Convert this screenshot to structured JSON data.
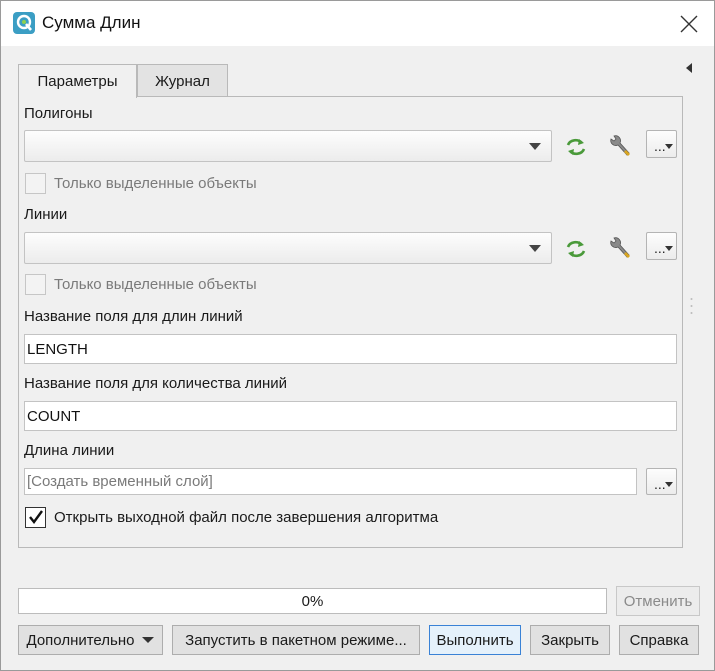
{
  "window": {
    "title": "Сумма Длин"
  },
  "tabs": [
    {
      "label": "Параметры",
      "active": true
    },
    {
      "label": "Журнал",
      "active": false
    }
  ],
  "params": {
    "polygons": {
      "label": "Полигоны",
      "value": "",
      "selected_only_label": "Только выделенные объекты",
      "selected_only_checked": false
    },
    "lines": {
      "label": "Линии",
      "value": "",
      "selected_only_label": "Только выделенные объекты",
      "selected_only_checked": false
    },
    "length_field": {
      "label": "Название поля для длин линий",
      "value": "LENGTH"
    },
    "count_field": {
      "label": "Название поля для количества линий",
      "value": "COUNT"
    },
    "output": {
      "label": "Длина линии",
      "placeholder": "[Создать временный слой]"
    },
    "open_output": {
      "label": "Открыть выходной файл после завершения алгоритма",
      "checked": true
    },
    "dots_label": "..."
  },
  "progress": {
    "text": "0%",
    "value": 0
  },
  "buttons": {
    "cancel": "Отменить",
    "advanced": "Дополнительно",
    "batch": "Запустить в пакетном режиме...",
    "run": "Выполнить",
    "close": "Закрыть",
    "help": "Справка"
  },
  "icons": [
    "qgis-logo-icon",
    "close-icon",
    "collapse-arrow-icon",
    "refresh-icon",
    "wrench-icon"
  ],
  "colors": {
    "accent_green": "#4a9a3a",
    "default_button_border": "#3a82d6"
  }
}
